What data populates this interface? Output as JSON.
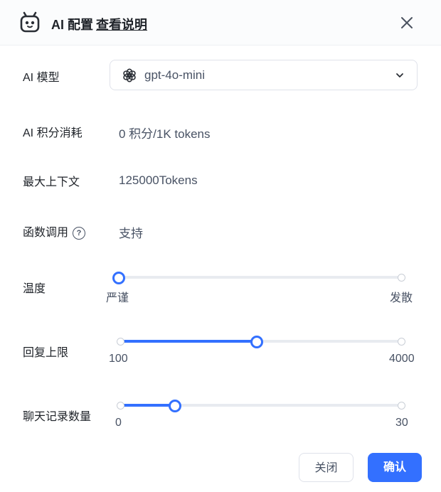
{
  "header": {
    "title": "AI 配置",
    "doc_link": "查看说明"
  },
  "fields": {
    "model_label": "AI 模型",
    "model_value": "gpt-4o-mini",
    "points_label": "AI 积分消耗",
    "points_value": "0 积分/1K tokens",
    "context_label": "最大上下文",
    "context_value": "125000Tokens",
    "function_label": "函数调用",
    "function_value": "支持"
  },
  "temperature": {
    "label": "温度",
    "min_label": "严谨",
    "max_label": "发散",
    "value_fraction": 0.0
  },
  "max_reply": {
    "label": "回复上限",
    "min": "100",
    "max": "4000",
    "value_fraction": 0.49
  },
  "history": {
    "label": "聊天记录数量",
    "min": "0",
    "max": "30",
    "value_fraction": 0.2
  },
  "footer": {
    "close_label": "关闭",
    "confirm_label": "确认"
  },
  "colors": {
    "accent": "#3370ff",
    "track": "#e8ebf0"
  },
  "icons": [
    "robot-icon",
    "close-icon",
    "openai-icon",
    "chevron-down-icon",
    "help-icon"
  ]
}
